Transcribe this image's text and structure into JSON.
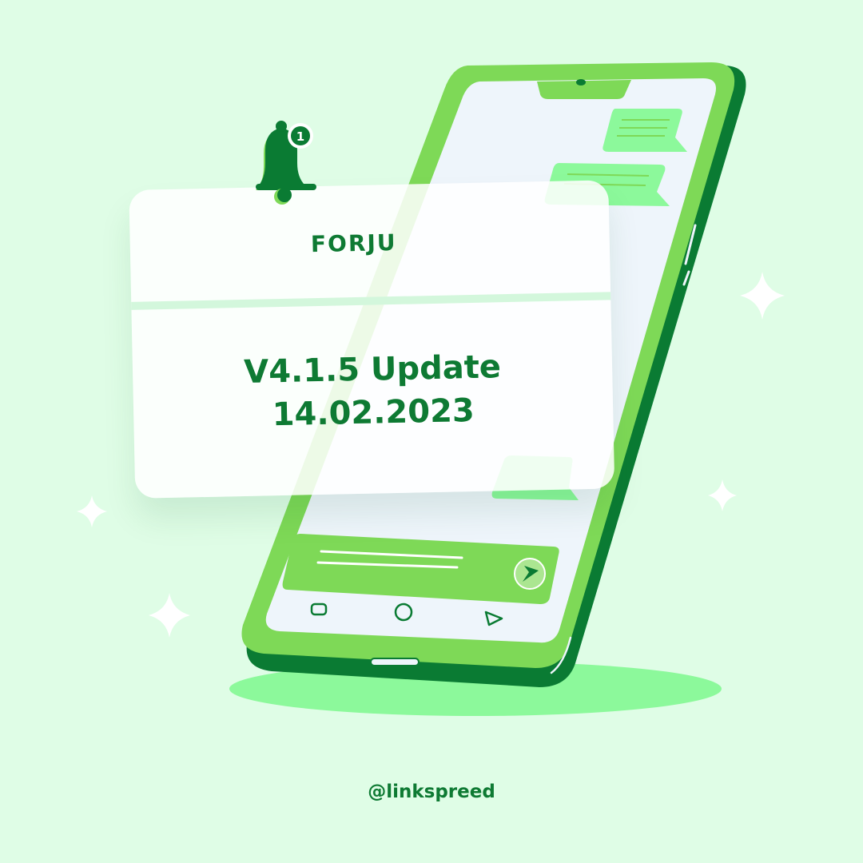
{
  "notification": {
    "badge_count": "1",
    "brand": "FORJU",
    "version_line": "V4.1.5 Update",
    "date_line": "14.02.2023"
  },
  "footer": {
    "handle": "@linkspreed"
  },
  "colors": {
    "background": "#dffde6",
    "accent_dark": "#0e7a33",
    "accent_light": "#7ed957",
    "bubble": "#8cf99b",
    "screen": "#eef5fb"
  },
  "icons": [
    "bell-icon",
    "sparkle-icon",
    "send-icon",
    "nav-square-icon",
    "nav-circle-icon",
    "nav-triangle-icon"
  ]
}
